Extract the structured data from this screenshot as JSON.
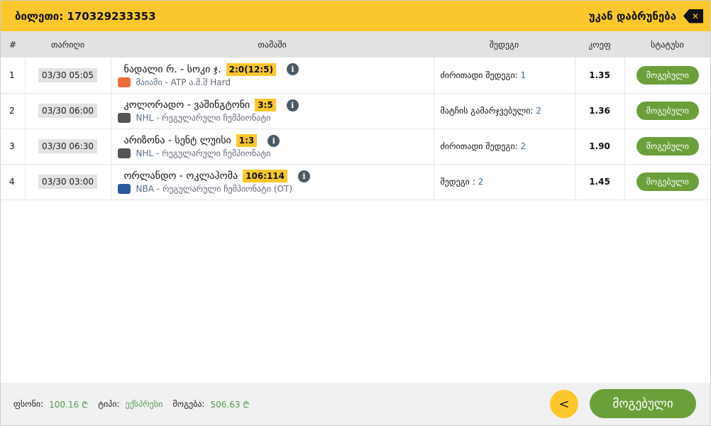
{
  "header": {
    "ticket": "ბილეთი: 170329233353",
    "back": "უკან დაბრუნება"
  },
  "columns": [
    "#",
    "თარიღი",
    "თამაში",
    "შედეგი",
    "კოეფ",
    "სტატუსი"
  ],
  "rows": [
    {
      "n": "1",
      "date": "03/30 05:05",
      "game": "ნადალი რ. - სოკი ჯ.",
      "score": "2:0(12:5)",
      "league_a": "მაიამი",
      "league_b": " - ATP ა.შ.შ Hard",
      "out_label": "ძირითადი შედეგი: ",
      "out_val": "1",
      "odd": "1.35",
      "status": "მოგებული"
    },
    {
      "n": "2",
      "date": "03/30 06:00",
      "game": "კოლორადო - ვაშინგტონი",
      "score": "3:5",
      "league_a": "NHL",
      "league_b": " - რეგულარული ჩემპიონატი",
      "out_label": "მატჩის გამარჯვებული: ",
      "out_val": "2",
      "odd": "1.36",
      "status": "მოგებული"
    },
    {
      "n": "3",
      "date": "03/30 06:30",
      "game": "არიზონა - სენტ ლუისი",
      "score": "1:3",
      "league_a": "NHL",
      "league_b": " - რეგულარული ჩემპიონატი",
      "out_label": "ძირითადი შედეგი: ",
      "out_val": "2",
      "odd": "1.90",
      "status": "მოგებული"
    },
    {
      "n": "4",
      "date": "03/30 03:00",
      "game": "ორლანდო - ოკლაჰომა",
      "score": "106:114",
      "league_a": "NBA",
      "league_b": " - რეგულარული ჩემპიონატი (OT)",
      "out_label": "შედეგი : ",
      "out_val": "2",
      "odd": "1.45",
      "status": "მოგებული"
    }
  ],
  "footer": {
    "stake_label": "ფსონი:",
    "stake": "100.16 ₾",
    "type_label": "ტიპი:",
    "type": "ექსპრესი",
    "win_label": "მოგება:",
    "win": "506.63 ₾",
    "button": "მოგებული"
  },
  "colors": {
    "accent": "#fcc72c",
    "success": "#6a9f3a"
  }
}
